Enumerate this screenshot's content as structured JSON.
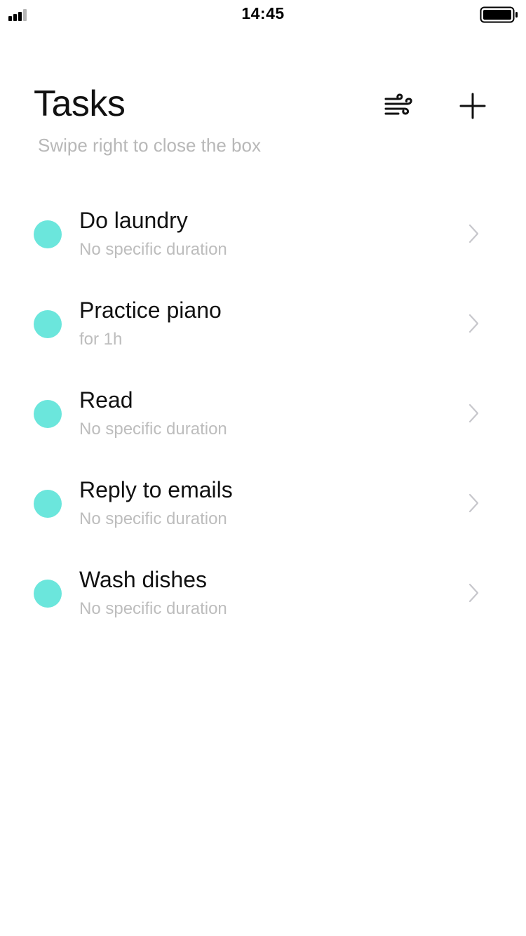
{
  "status_bar": {
    "time": "14:45",
    "signal_icon": "cellular-signal-icon",
    "battery_icon": "battery-icon"
  },
  "header": {
    "title": "Tasks",
    "subtitle": "Swipe right to close the box",
    "filter_icon": "wind-icon",
    "add_icon": "plus-icon"
  },
  "colors": {
    "accent": "#6be6dc",
    "subtitle_gray": "#b8b8b8",
    "chevron_gray": "#c7c7cc"
  },
  "tasks": [
    {
      "title": "Do laundry",
      "duration": "No specific duration"
    },
    {
      "title": "Practice piano",
      "duration": "for 1h"
    },
    {
      "title": "Read",
      "duration": "No specific duration"
    },
    {
      "title": "Reply to emails",
      "duration": "No specific duration"
    },
    {
      "title": "Wash dishes",
      "duration": "No specific duration"
    }
  ]
}
